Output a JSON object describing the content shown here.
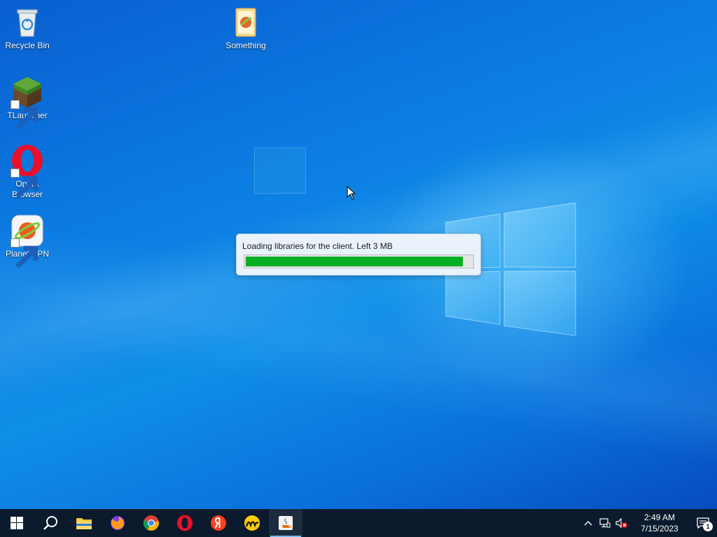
{
  "desktop": {
    "icons": [
      {
        "label": "Recycle Bin",
        "icon": "recycle-bin-icon"
      },
      {
        "label": "Something",
        "icon": "folder-icon"
      },
      {
        "label": "TLauncher",
        "icon": "tlauncher-icon"
      },
      {
        "label": "Opera Browser",
        "icon": "opera-icon"
      },
      {
        "label": "Planet VPN",
        "icon": "planet-vpn-icon"
      }
    ]
  },
  "loader": {
    "message": "Loading libraries for the client. Left 3 MB",
    "progress_fraction": 0.96,
    "bar_color": "#06b025"
  },
  "taskbar": {
    "items": [
      {
        "icon": "windows-start-icon"
      },
      {
        "icon": "search-icon"
      },
      {
        "icon": "file-explorer-icon"
      },
      {
        "icon": "firefox-icon"
      },
      {
        "icon": "chrome-icon"
      },
      {
        "icon": "opera-icon"
      },
      {
        "icon": "yandex-icon"
      },
      {
        "icon": "yandex-music-icon"
      },
      {
        "icon": "java-icon",
        "active": true
      }
    ],
    "tray": {
      "time": "2:49 AM",
      "date": "7/15/2023",
      "notification_count": "1"
    }
  },
  "colors": {
    "taskbar_bg": "#0b1a2c",
    "desktop_blue": "#0b78e0"
  }
}
